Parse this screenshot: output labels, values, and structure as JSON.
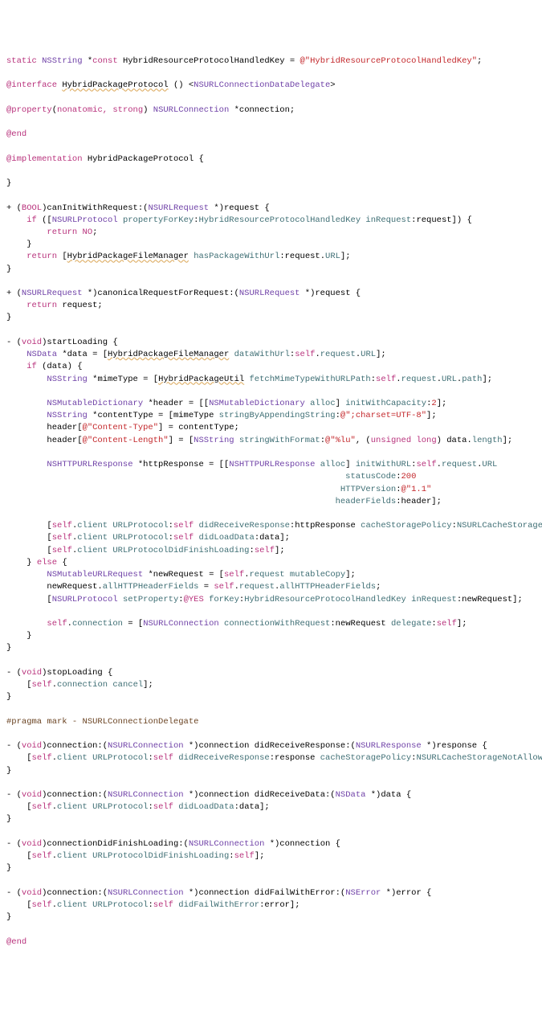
{
  "lines": [
    [
      [
        "kw",
        "static "
      ],
      [
        "cls",
        "NSString "
      ],
      [
        "var",
        "*"
      ],
      [
        "kw",
        "const "
      ],
      [
        "var",
        "HybridResourceProtocolHandledKey = "
      ],
      [
        "str",
        "@\"HybridResourceProtocolHandledKey\""
      ],
      [
        "var",
        ";"
      ]
    ],
    [
      [
        "var",
        ""
      ]
    ],
    [
      [
        "kw",
        "@interface "
      ],
      [
        "uline",
        "HybridPackageProtocol"
      ],
      [
        "var",
        " () <"
      ],
      [
        "cls",
        "NSURLConnectionDataDelegate"
      ],
      [
        "var",
        ">"
      ]
    ],
    [
      [
        "var",
        ""
      ]
    ],
    [
      [
        "kw",
        "@property"
      ],
      [
        "var",
        "("
      ],
      [
        "kw",
        "nonatomic, strong"
      ],
      [
        "var",
        ") "
      ],
      [
        "cls",
        "NSURLConnection "
      ],
      [
        "var",
        "*connection;"
      ]
    ],
    [
      [
        "var",
        ""
      ]
    ],
    [
      [
        "kw",
        "@end"
      ]
    ],
    [
      [
        "var",
        ""
      ]
    ],
    [
      [
        "kw",
        "@implementation "
      ],
      [
        "var",
        "HybridPackageProtocol {"
      ]
    ],
    [
      [
        "var",
        ""
      ]
    ],
    [
      [
        "var",
        "}"
      ]
    ],
    [
      [
        "var",
        ""
      ]
    ],
    [
      [
        "var",
        "+ ("
      ],
      [
        "kw",
        "BOOL"
      ],
      [
        "var",
        ")canInitWithRequest:("
      ],
      [
        "cls",
        "NSURLRequest "
      ],
      [
        "var",
        "*)request {"
      ]
    ],
    [
      [
        "var",
        "    "
      ],
      [
        "kw",
        "if "
      ],
      [
        "var",
        "(["
      ],
      [
        "cls",
        "NSURLProtocol "
      ],
      [
        "mth",
        "propertyForKey"
      ],
      [
        "var",
        ":"
      ],
      [
        "mth",
        "HybridResourceProtocolHandledKey "
      ],
      [
        "mth",
        "inRequest"
      ],
      [
        "var",
        ":request]) {"
      ]
    ],
    [
      [
        "var",
        "        "
      ],
      [
        "kw",
        "return "
      ],
      [
        "kw",
        "NO"
      ],
      [
        "var",
        ";"
      ]
    ],
    [
      [
        "var",
        "    }"
      ]
    ],
    [
      [
        "var",
        "    "
      ],
      [
        "kw",
        "return "
      ],
      [
        "var",
        "["
      ],
      [
        "uline",
        "HybridPackageFileManager"
      ],
      [
        "var",
        " "
      ],
      [
        "mth",
        "hasPackageWithUrl"
      ],
      [
        "var",
        ":request."
      ],
      [
        "mth",
        "URL"
      ],
      [
        "var",
        "];"
      ]
    ],
    [
      [
        "var",
        "}"
      ]
    ],
    [
      [
        "var",
        ""
      ]
    ],
    [
      [
        "var",
        "+ ("
      ],
      [
        "cls",
        "NSURLRequest "
      ],
      [
        "var",
        "*)canonicalRequestForRequest:("
      ],
      [
        "cls",
        "NSURLRequest "
      ],
      [
        "var",
        "*)request {"
      ]
    ],
    [
      [
        "var",
        "    "
      ],
      [
        "kw",
        "return "
      ],
      [
        "var",
        "request;"
      ]
    ],
    [
      [
        "var",
        "}"
      ]
    ],
    [
      [
        "var",
        ""
      ]
    ],
    [
      [
        "var",
        "- ("
      ],
      [
        "kw",
        "void"
      ],
      [
        "var",
        ")startLoading {"
      ]
    ],
    [
      [
        "var",
        "    "
      ],
      [
        "cls",
        "NSData "
      ],
      [
        "var",
        "*data = ["
      ],
      [
        "uline",
        "HybridPackageFileManager"
      ],
      [
        "var",
        " "
      ],
      [
        "mth",
        "dataWithUrl"
      ],
      [
        "var",
        ":"
      ],
      [
        "kw",
        "self"
      ],
      [
        "var",
        "."
      ],
      [
        "mth",
        "request"
      ],
      [
        "var",
        "."
      ],
      [
        "mth",
        "URL"
      ],
      [
        "var",
        "];"
      ]
    ],
    [
      [
        "var",
        "    "
      ],
      [
        "kw",
        "if "
      ],
      [
        "var",
        "(data) {"
      ]
    ],
    [
      [
        "var",
        "        "
      ],
      [
        "cls",
        "NSString "
      ],
      [
        "var",
        "*mimeType = ["
      ],
      [
        "uline",
        "HybridPackageUtil"
      ],
      [
        "var",
        " "
      ],
      [
        "mth",
        "fetchMimeTypeWithURLPath"
      ],
      [
        "var",
        ":"
      ],
      [
        "kw",
        "self"
      ],
      [
        "var",
        "."
      ],
      [
        "mth",
        "request"
      ],
      [
        "var",
        "."
      ],
      [
        "mth",
        "URL"
      ],
      [
        "var",
        "."
      ],
      [
        "mth",
        "path"
      ],
      [
        "var",
        "];"
      ]
    ],
    [
      [
        "var",
        ""
      ]
    ],
    [
      [
        "var",
        "        "
      ],
      [
        "cls",
        "NSMutableDictionary "
      ],
      [
        "var",
        "*header = [["
      ],
      [
        "cls",
        "NSMutableDictionary "
      ],
      [
        "mth",
        "alloc"
      ],
      [
        "var",
        "] "
      ],
      [
        "mth",
        "initWithCapacity"
      ],
      [
        "var",
        ":"
      ],
      [
        "str",
        "2"
      ],
      [
        "var",
        "];"
      ]
    ],
    [
      [
        "var",
        "        "
      ],
      [
        "cls",
        "NSString "
      ],
      [
        "var",
        "*contentType = [mimeType "
      ],
      [
        "mth",
        "stringByAppendingString"
      ],
      [
        "var",
        ":"
      ],
      [
        "str",
        "@\";charset=UTF-8\""
      ],
      [
        "var",
        "];"
      ]
    ],
    [
      [
        "var",
        "        header["
      ],
      [
        "str",
        "@\"Content-Type\""
      ],
      [
        "var",
        "] = contentType;"
      ]
    ],
    [
      [
        "var",
        "        header["
      ],
      [
        "str",
        "@\"Content-Length\""
      ],
      [
        "var",
        "] = ["
      ],
      [
        "cls",
        "NSString "
      ],
      [
        "mth",
        "stringWithFormat"
      ],
      [
        "var",
        ":"
      ],
      [
        "str",
        "@\"%lu\""
      ],
      [
        "var",
        ", ("
      ],
      [
        "kw",
        "unsigned long"
      ],
      [
        "var",
        ") data."
      ],
      [
        "mth",
        "length"
      ],
      [
        "var",
        "];"
      ]
    ],
    [
      [
        "var",
        ""
      ]
    ],
    [
      [
        "var",
        "        "
      ],
      [
        "cls",
        "NSHTTPURLResponse "
      ],
      [
        "var",
        "*httpResponse = [["
      ],
      [
        "cls",
        "NSHTTPURLResponse "
      ],
      [
        "mth",
        "alloc"
      ],
      [
        "var",
        "] "
      ],
      [
        "mth",
        "initWithURL"
      ],
      [
        "var",
        ":"
      ],
      [
        "kw",
        "self"
      ],
      [
        "var",
        "."
      ],
      [
        "mth",
        "request"
      ],
      [
        "var",
        "."
      ],
      [
        "mth",
        "URL"
      ]
    ],
    [
      [
        "var",
        "                                                                   "
      ],
      [
        "mth",
        "statusCode"
      ],
      [
        "var",
        ":"
      ],
      [
        "str",
        "200"
      ]
    ],
    [
      [
        "var",
        "                                                                  "
      ],
      [
        "mth",
        "HTTPVersion"
      ],
      [
        "var",
        ":"
      ],
      [
        "str",
        "@\"1.1\""
      ]
    ],
    [
      [
        "var",
        "                                                                 "
      ],
      [
        "mth",
        "headerFields"
      ],
      [
        "var",
        ":header];"
      ]
    ],
    [
      [
        "var",
        ""
      ]
    ],
    [
      [
        "var",
        "        ["
      ],
      [
        "kw",
        "self"
      ],
      [
        "var",
        "."
      ],
      [
        "mth",
        "client "
      ],
      [
        "mth",
        "URLProtocol"
      ],
      [
        "var",
        ":"
      ],
      [
        "kw",
        "self "
      ],
      [
        "mth",
        "didReceiveResponse"
      ],
      [
        "var",
        ":httpResponse "
      ],
      [
        "mth",
        "cacheStoragePolicy"
      ],
      [
        "var",
        ":"
      ],
      [
        "mth",
        "NSURLCacheStorageNotAllowed"
      ],
      [
        "var",
        "];"
      ]
    ],
    [
      [
        "var",
        "        ["
      ],
      [
        "kw",
        "self"
      ],
      [
        "var",
        "."
      ],
      [
        "mth",
        "client "
      ],
      [
        "mth",
        "URLProtocol"
      ],
      [
        "var",
        ":"
      ],
      [
        "kw",
        "self "
      ],
      [
        "mth",
        "didLoadData"
      ],
      [
        "var",
        ":data];"
      ]
    ],
    [
      [
        "var",
        "        ["
      ],
      [
        "kw",
        "self"
      ],
      [
        "var",
        "."
      ],
      [
        "mth",
        "client "
      ],
      [
        "mth",
        "URLProtocolDidFinishLoading"
      ],
      [
        "var",
        ":"
      ],
      [
        "kw",
        "self"
      ],
      [
        "var",
        "];"
      ]
    ],
    [
      [
        "var",
        "    } "
      ],
      [
        "kw",
        "else "
      ],
      [
        "var",
        "{"
      ]
    ],
    [
      [
        "var",
        "        "
      ],
      [
        "cls",
        "NSMutableURLRequest "
      ],
      [
        "var",
        "*newRequest = ["
      ],
      [
        "kw",
        "self"
      ],
      [
        "var",
        "."
      ],
      [
        "mth",
        "request "
      ],
      [
        "mth",
        "mutableCopy"
      ],
      [
        "var",
        "];"
      ]
    ],
    [
      [
        "var",
        "        newRequest."
      ],
      [
        "mth",
        "allHTTPHeaderFields"
      ],
      [
        "var",
        " = "
      ],
      [
        "kw",
        "self"
      ],
      [
        "var",
        "."
      ],
      [
        "mth",
        "request"
      ],
      [
        "var",
        "."
      ],
      [
        "mth",
        "allHTTPHeaderFields"
      ],
      [
        "var",
        ";"
      ]
    ],
    [
      [
        "var",
        "        ["
      ],
      [
        "cls",
        "NSURLProtocol "
      ],
      [
        "mth",
        "setProperty"
      ],
      [
        "var",
        ":"
      ],
      [
        "kw",
        "@YES "
      ],
      [
        "mth",
        "forKey"
      ],
      [
        "var",
        ":"
      ],
      [
        "mth",
        "HybridResourceProtocolHandledKey "
      ],
      [
        "mth",
        "inRequest"
      ],
      [
        "var",
        ":newRequest];"
      ]
    ],
    [
      [
        "var",
        ""
      ]
    ],
    [
      [
        "var",
        "        "
      ],
      [
        "kw",
        "self"
      ],
      [
        "var",
        "."
      ],
      [
        "mth",
        "connection"
      ],
      [
        "var",
        " = ["
      ],
      [
        "cls",
        "NSURLConnection "
      ],
      [
        "mth",
        "connectionWithRequest"
      ],
      [
        "var",
        ":newRequest "
      ],
      [
        "mth",
        "delegate"
      ],
      [
        "var",
        ":"
      ],
      [
        "kw",
        "self"
      ],
      [
        "var",
        "];"
      ]
    ],
    [
      [
        "var",
        "    }"
      ]
    ],
    [
      [
        "var",
        "}"
      ]
    ],
    [
      [
        "var",
        ""
      ]
    ],
    [
      [
        "var",
        "- ("
      ],
      [
        "kw",
        "void"
      ],
      [
        "var",
        ")stopLoading {"
      ]
    ],
    [
      [
        "var",
        "    ["
      ],
      [
        "kw",
        "self"
      ],
      [
        "var",
        "."
      ],
      [
        "mth",
        "connection "
      ],
      [
        "mth",
        "cancel"
      ],
      [
        "var",
        "];"
      ]
    ],
    [
      [
        "var",
        "}"
      ]
    ],
    [
      [
        "var",
        ""
      ]
    ],
    [
      [
        "prag",
        "#pragma mark - NSURLConnectionDelegate"
      ]
    ],
    [
      [
        "var",
        ""
      ]
    ],
    [
      [
        "var",
        "- ("
      ],
      [
        "kw",
        "void"
      ],
      [
        "var",
        ")connection:("
      ],
      [
        "cls",
        "NSURLConnection "
      ],
      [
        "var",
        "*)connection didReceiveResponse:("
      ],
      [
        "cls",
        "NSURLResponse "
      ],
      [
        "var",
        "*)response {"
      ]
    ],
    [
      [
        "var",
        "    ["
      ],
      [
        "kw",
        "self"
      ],
      [
        "var",
        "."
      ],
      [
        "mth",
        "client "
      ],
      [
        "mth",
        "URLProtocol"
      ],
      [
        "var",
        ":"
      ],
      [
        "kw",
        "self "
      ],
      [
        "mth",
        "didReceiveResponse"
      ],
      [
        "var",
        ":response "
      ],
      [
        "mth",
        "cacheStoragePolicy"
      ],
      [
        "var",
        ":"
      ],
      [
        "mth",
        "NSURLCacheStorageNotAllowed"
      ],
      [
        "var",
        "];"
      ]
    ],
    [
      [
        "var",
        "}"
      ]
    ],
    [
      [
        "var",
        ""
      ]
    ],
    [
      [
        "var",
        "- ("
      ],
      [
        "kw",
        "void"
      ],
      [
        "var",
        ")connection:("
      ],
      [
        "cls",
        "NSURLConnection "
      ],
      [
        "var",
        "*)connection didReceiveData:("
      ],
      [
        "cls",
        "NSData "
      ],
      [
        "var",
        "*)data {"
      ]
    ],
    [
      [
        "var",
        "    ["
      ],
      [
        "kw",
        "self"
      ],
      [
        "var",
        "."
      ],
      [
        "mth",
        "client "
      ],
      [
        "mth",
        "URLProtocol"
      ],
      [
        "var",
        ":"
      ],
      [
        "kw",
        "self "
      ],
      [
        "mth",
        "didLoadData"
      ],
      [
        "var",
        ":data];"
      ]
    ],
    [
      [
        "var",
        "}"
      ]
    ],
    [
      [
        "var",
        ""
      ]
    ],
    [
      [
        "var",
        "- ("
      ],
      [
        "kw",
        "void"
      ],
      [
        "var",
        ")connectionDidFinishLoading:("
      ],
      [
        "cls",
        "NSURLConnection "
      ],
      [
        "var",
        "*)connection {"
      ]
    ],
    [
      [
        "var",
        "    ["
      ],
      [
        "kw",
        "self"
      ],
      [
        "var",
        "."
      ],
      [
        "mth",
        "client "
      ],
      [
        "mth",
        "URLProtocolDidFinishLoading"
      ],
      [
        "var",
        ":"
      ],
      [
        "kw",
        "self"
      ],
      [
        "var",
        "];"
      ]
    ],
    [
      [
        "var",
        "}"
      ]
    ],
    [
      [
        "var",
        ""
      ]
    ],
    [
      [
        "var",
        "- ("
      ],
      [
        "kw",
        "void"
      ],
      [
        "var",
        ")connection:("
      ],
      [
        "cls",
        "NSURLConnection "
      ],
      [
        "var",
        "*)connection didFailWithError:("
      ],
      [
        "cls",
        "NSError "
      ],
      [
        "var",
        "*)error {"
      ]
    ],
    [
      [
        "var",
        "    ["
      ],
      [
        "kw",
        "self"
      ],
      [
        "var",
        "."
      ],
      [
        "mth",
        "client "
      ],
      [
        "mth",
        "URLProtocol"
      ],
      [
        "var",
        ":"
      ],
      [
        "kw",
        "self "
      ],
      [
        "mth",
        "didFailWithError"
      ],
      [
        "var",
        ":error];"
      ]
    ],
    [
      [
        "var",
        "}"
      ]
    ],
    [
      [
        "var",
        ""
      ]
    ],
    [
      [
        "kw",
        "@end"
      ]
    ]
  ]
}
